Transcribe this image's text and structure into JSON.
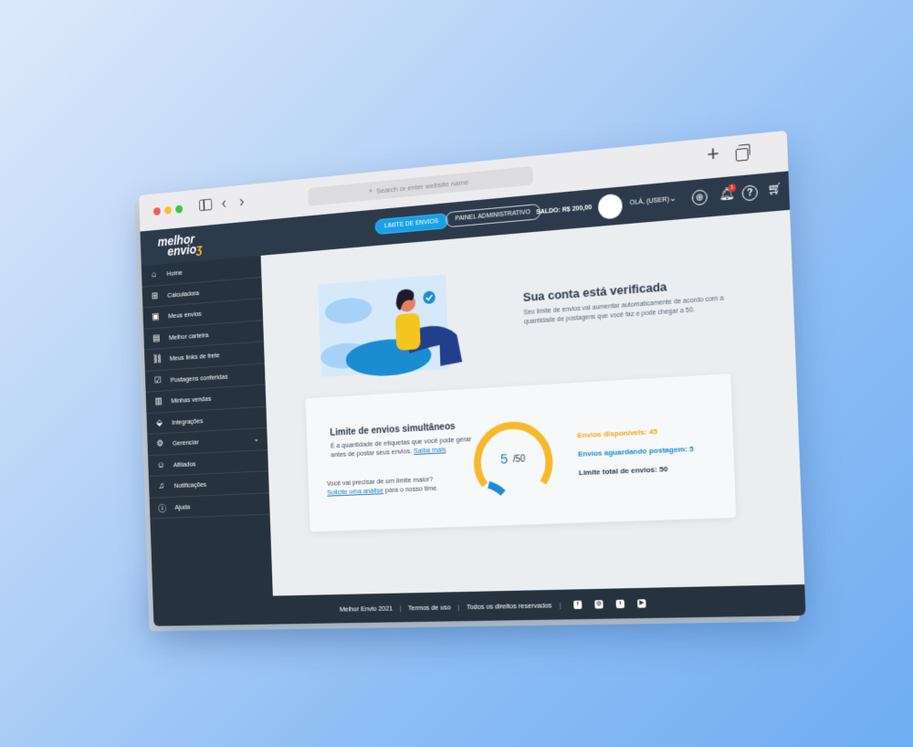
{
  "browser": {
    "address_placeholder": "Search or enter website name",
    "back_icon": "chevron-left-icon",
    "forward_icon": "chevron-right-icon"
  },
  "header": {
    "logo_line1": "melhor",
    "logo_line2": "envio",
    "limite_button": "LIMITE DE ENVIOS",
    "painel_button": "PAINEL ADMINISTRATIVO",
    "saldo": "SALDO: R$ 200,00",
    "greeting": "OLÁ, (USER)",
    "notification_count": "1"
  },
  "sidebar": {
    "items": [
      {
        "label": "Home",
        "icon": "home-icon"
      },
      {
        "label": "Calculadora",
        "icon": "calculator-icon"
      },
      {
        "label": "Meus envios",
        "icon": "box-icon"
      },
      {
        "label": "Melhor carteira",
        "icon": "wallet-icon"
      },
      {
        "label": "Meus links de frete",
        "icon": "link-icon"
      },
      {
        "label": "Postagens conferidas",
        "icon": "check-list-icon"
      },
      {
        "label": "Minhas vendas",
        "icon": "shopping-bag-icon"
      },
      {
        "label": "Integrações",
        "icon": "integrations-icon"
      },
      {
        "label": "Gerenciar",
        "icon": "gear-icon"
      },
      {
        "label": "Afiliados",
        "icon": "users-icon"
      },
      {
        "label": "Notificações",
        "icon": "bell-icon"
      },
      {
        "label": "Ajuda",
        "icon": "help-icon"
      }
    ]
  },
  "verified": {
    "title": "Sua conta está verificada",
    "description": "Seu limite de envios vai aumentar automaticamente de acordo com a quantidade de postagens que você faz e pode chegar a 50."
  },
  "limit_card": {
    "title": "Limite de envios simultâneos",
    "description": "É a quantidade de etiquetas que você pode gerar antes de postar seus envios.",
    "learn_more": "Saiba mais",
    "question": "Você vai precisar de um limite maior?",
    "request_link": "Solicite uma análise",
    "request_suffix": "para o nosso time.",
    "gauge_value": "5",
    "gauge_total": "/50",
    "gauge_fraction": 0.1,
    "available": "Envios disponíveis: 45",
    "awaiting": "Envios aguardando postagem: 5",
    "total": "Limite total de envios: 50",
    "colors": {
      "available": "#f3a712",
      "awaiting": "#1a8cd0"
    }
  },
  "footer": {
    "copyright": "Melhor Envio 2021",
    "terms": "Termos de uso",
    "rights": "Todos os direitos reservados"
  }
}
